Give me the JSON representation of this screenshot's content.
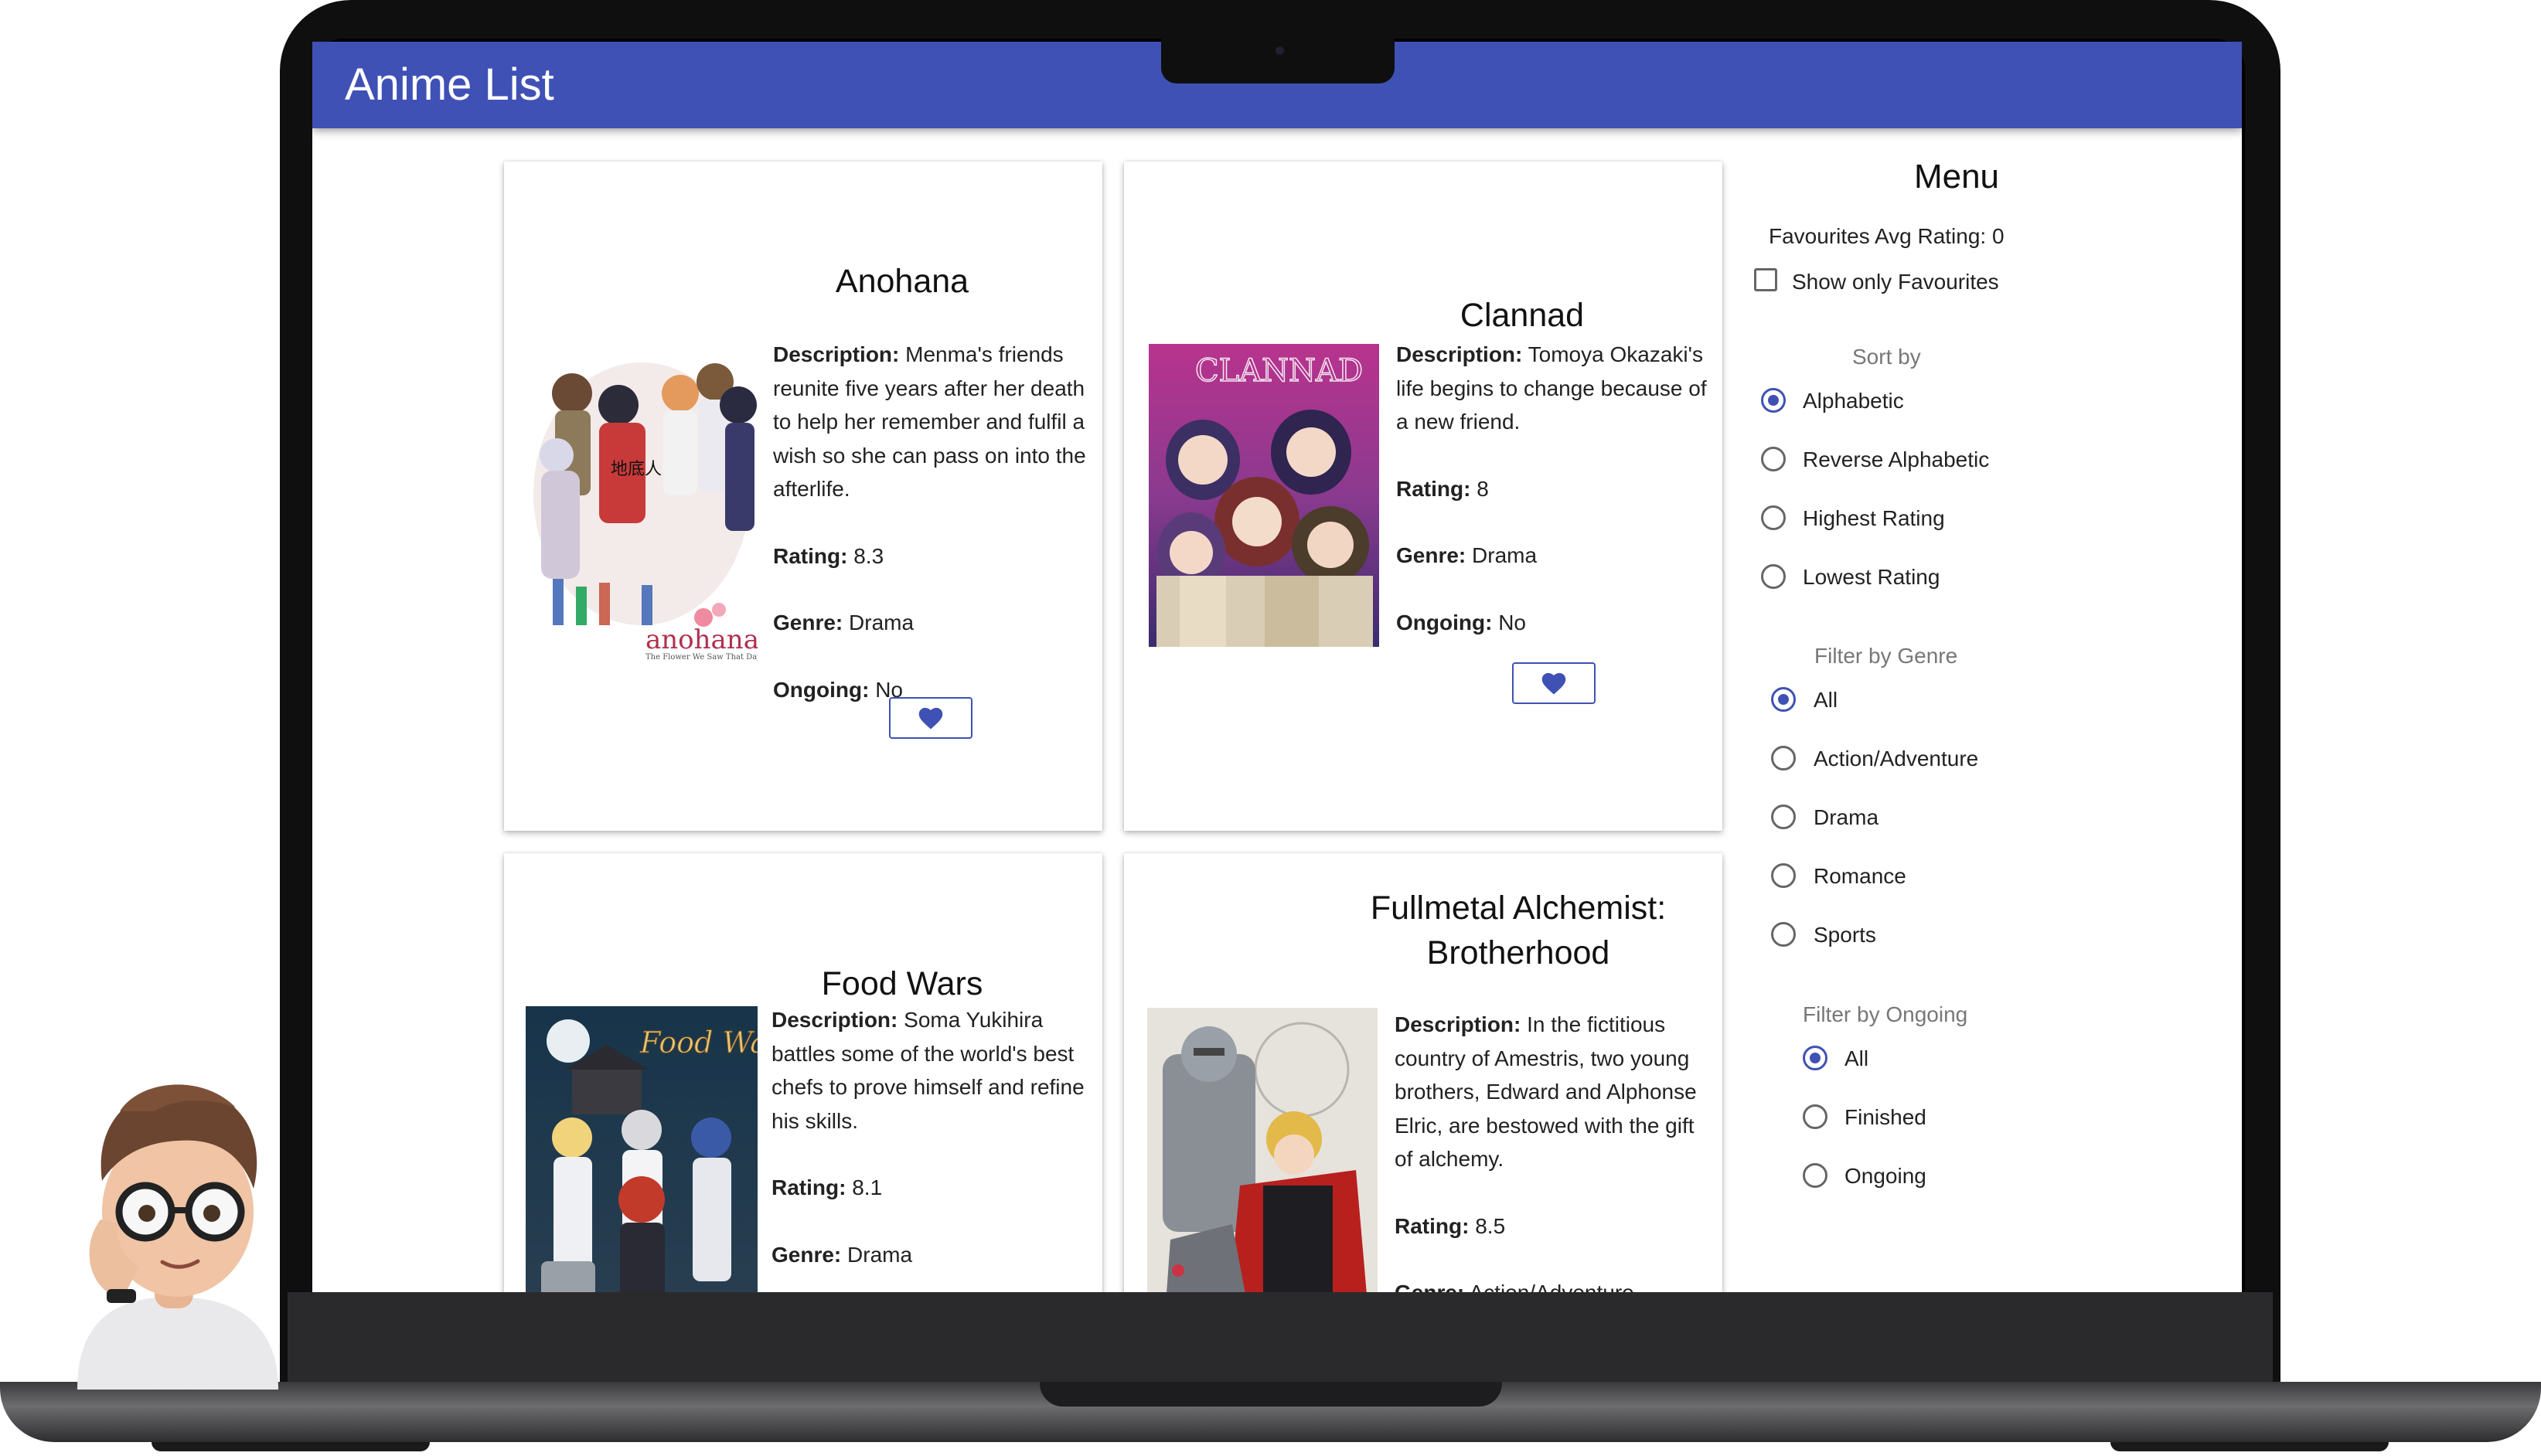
{
  "app": {
    "title": "Anime List"
  },
  "cards": [
    {
      "title": "Anohana",
      "description_label": "Description:",
      "description": "Menma's friends reunite five years after her death to help her remember and fulfil a wish so she can pass on into the afterlife.",
      "rating_label": "Rating:",
      "rating": "8.3",
      "genre_label": "Genre:",
      "genre": "Drama",
      "ongoing_label": "Ongoing:",
      "ongoing": "No",
      "cover_logo": "anohana",
      "cover_subtitle": "The Flower We Saw That Day",
      "cover_kanji": "地底人"
    },
    {
      "title": "Clannad",
      "description_label": "Description:",
      "description": "Tomoya Okazaki's life begins to change because of a new friend.",
      "rating_label": "Rating:",
      "rating": "8",
      "genre_label": "Genre:",
      "genre": "Drama",
      "ongoing_label": "Ongoing:",
      "ongoing": "No",
      "cover_logo": "CLANNAD"
    },
    {
      "title": "Food Wars",
      "description_label": "Description:",
      "description": "Soma Yukihira battles some of the world's best chefs to prove himself and refine his skills.",
      "rating_label": "Rating:",
      "rating": "8.1",
      "genre_label": "Genre:",
      "genre": "Drama",
      "cover_logo": "Food Wars!"
    },
    {
      "title": "Fullmetal Alchemist: Brotherhood",
      "description_label": "Description:",
      "description": "In the fictitious country of Amestris, two young brothers, Edward and Alphonse Elric, are bestowed with the gift of alchemy.",
      "rating_label": "Rating:",
      "rating": "8.5",
      "genre_label": "Genre:",
      "genre": "Action/Adventure"
    }
  ],
  "menu": {
    "title": "Menu",
    "favourites_avg": "Favourites Avg Rating: 0",
    "show_only_favourites": "Show only Favourites",
    "sort_by": {
      "label": "Sort by",
      "options": [
        "Alphabetic",
        "Reverse Alphabetic",
        "Highest Rating",
        "Lowest Rating"
      ],
      "selected": "Alphabetic"
    },
    "filter_genre": {
      "label": "Filter by Genre",
      "options": [
        "All",
        "Action/Adventure",
        "Drama",
        "Romance",
        "Sports"
      ],
      "selected": "All"
    },
    "filter_ongoing": {
      "label": "Filter by Ongoing",
      "options": [
        "All",
        "Finished",
        "Ongoing"
      ],
      "selected": "All"
    }
  },
  "colors": {
    "primary": "#3f51b5",
    "background": "#ffffff"
  },
  "icons": {
    "favourite": "heart-icon"
  }
}
